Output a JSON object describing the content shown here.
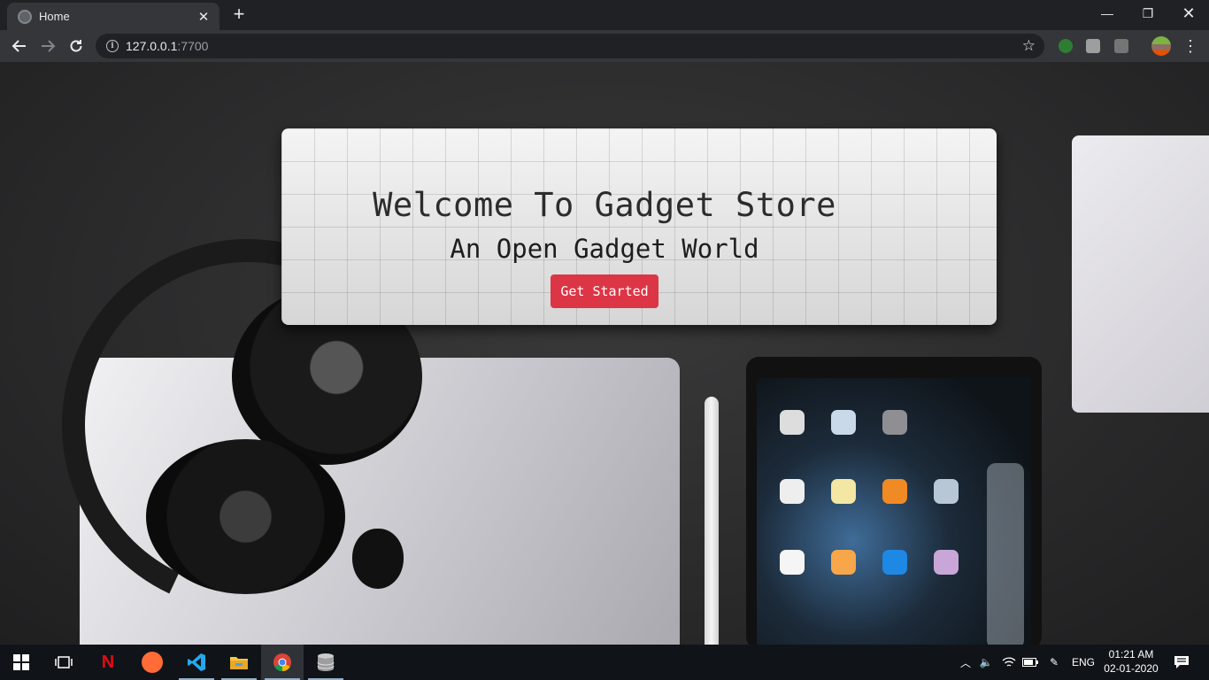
{
  "browser": {
    "tab_title": "Home",
    "new_tab_symbol": "+",
    "address": {
      "host": "127.0.0.1",
      "port": ":7700"
    }
  },
  "hero": {
    "title": "Welcome To Gadget Store",
    "subtitle": "An Open Gadget World",
    "cta_label": "Get Started",
    "cta_color": "#dc3545"
  },
  "taskbar": {
    "apps": [
      "windows-start-icon",
      "task-view-icon",
      "netflix-icon",
      "postman-icon",
      "vscode-icon",
      "file-explorer-icon",
      "chrome-icon",
      "database-icon"
    ],
    "language": "ENG",
    "time": "01:21 AM",
    "date": "02-01-2020"
  },
  "colors": {
    "browser_frame": "#202124",
    "toolbar": "#35363a",
    "taskbar": "#101418"
  }
}
